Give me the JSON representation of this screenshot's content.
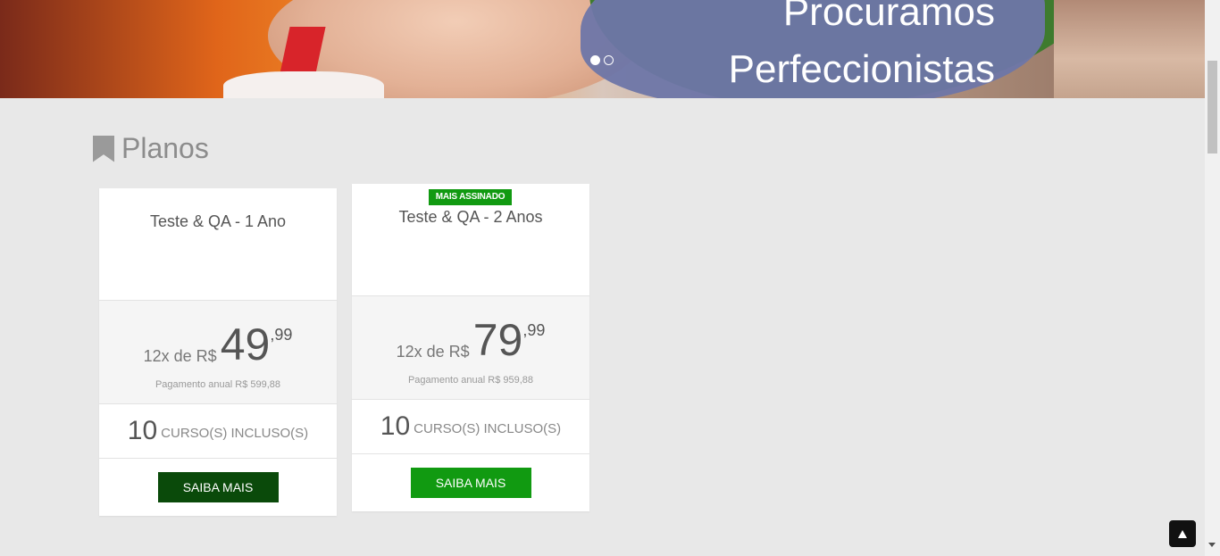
{
  "hero": {
    "title_line1": "Procuramos",
    "title_line2": "Perfeccionistas",
    "slides": 2,
    "active_slide": 1
  },
  "section": {
    "title": "Planos",
    "icon": "bookmark-icon"
  },
  "plans": [
    {
      "name": "Teste & QA - 1 Ano",
      "badge": "",
      "price_prefix": "12x de R$",
      "price_int": "49",
      "price_cents": ",99",
      "annual": "Pagamento anual R$ 599,88",
      "courses_count": "10",
      "courses_label": "CURSO(S) INCLUSO(S)",
      "cta": "SAIBA MAIS"
    },
    {
      "name": "Teste & QA - 2 Anos",
      "badge": "MAIS ASSINADO",
      "price_prefix": "12x de R$",
      "price_int": "79",
      "price_cents": ",99",
      "annual": "Pagamento anual R$ 959,88",
      "courses_count": "10",
      "courses_label": "CURSO(S) INCLUSO(S)",
      "cta": "SAIBA MAIS"
    }
  ],
  "colors": {
    "badge_green": "#119a11",
    "button_dark_green": "#0a4a0a",
    "button_green": "#119a11",
    "page_bg": "#e8e8e8"
  },
  "back_to_top": {
    "icon": "arrow-up-icon"
  }
}
